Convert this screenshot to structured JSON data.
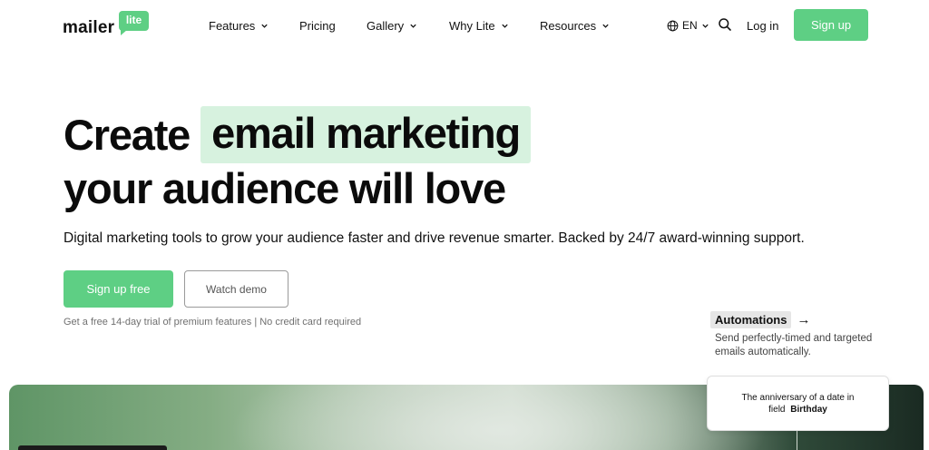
{
  "logo": {
    "word": "mailer",
    "badge": "lite"
  },
  "nav": {
    "features": "Features",
    "pricing": "Pricing",
    "gallery": "Gallery",
    "why_lite": "Why Lite",
    "resources": "Resources"
  },
  "header_actions": {
    "language": "EN",
    "login": "Log in",
    "signup": "Sign up"
  },
  "hero": {
    "title_start": "Create",
    "title_highlight": "email marketing",
    "title_line2": "your audience will love",
    "subtitle": "Digital marketing tools to grow your audience faster and drive revenue smarter. Backed by 24/7 award-winning support.",
    "cta_primary": "Sign up free",
    "cta_secondary": "Watch demo",
    "trial_note": "Get a free 14-day trial of premium features | No credit card required"
  },
  "automations": {
    "title": "Automations",
    "arrow": "→",
    "description": "Send perfectly-timed and targeted emails automatically."
  },
  "trigger_card": {
    "line1": "The anniversary of a date in",
    "line2_prefix": "field",
    "line2_value": "Birthday"
  },
  "colors": {
    "brand_green": "#5ecf84",
    "highlight_bg": "#d7f2df",
    "text": "#111111"
  },
  "icons": {
    "chevron": "chevron-down-icon",
    "globe": "globe-icon",
    "search": "search-icon",
    "arrow": "arrow-right-icon"
  }
}
